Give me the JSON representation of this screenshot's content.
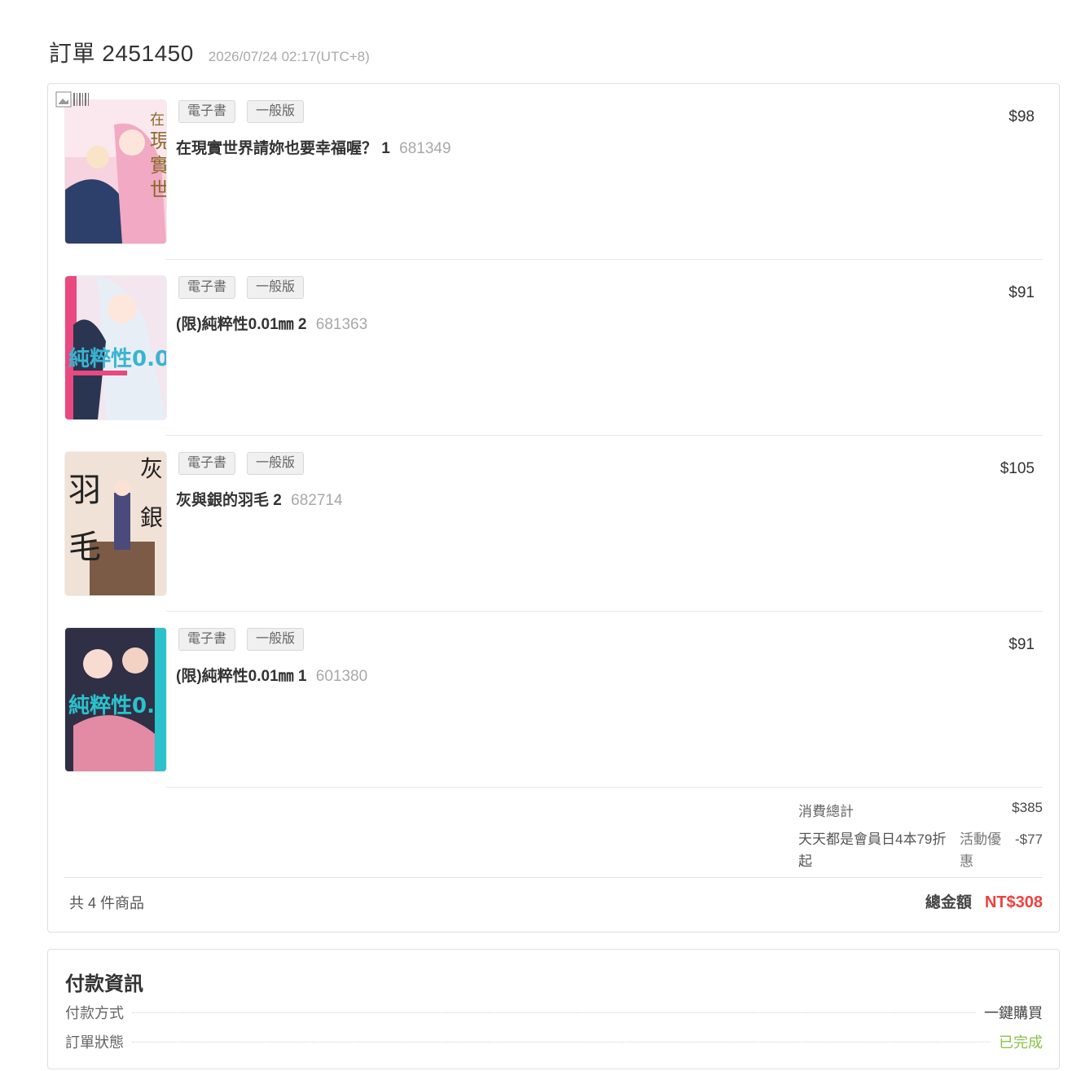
{
  "order": {
    "title": "訂單 2451450",
    "time": "2026/07/24 02:17(UTC+8)"
  },
  "items": [
    {
      "tags": [
        "電子書",
        "一般版"
      ],
      "name": "在現實世界請妳也要幸福喔？ 1",
      "code": "681349",
      "price": "$98",
      "cover_colors": [
        "#f6d3de",
        "#2d3f6b",
        "#f2a9c3"
      ]
    },
    {
      "tags": [
        "電子書",
        "一般版"
      ],
      "name": "(限)純粹性0.01㎜ 2",
      "code": "681363",
      "price": "$91",
      "cover_colors": [
        "#f3e6ee",
        "#e9497e",
        "#39b4cf"
      ]
    },
    {
      "tags": [
        "電子書",
        "一般版"
      ],
      "name": "灰與銀的羽毛 2",
      "code": "682714",
      "price": "$105",
      "cover_colors": [
        "#f0e2d6",
        "#7b5a46",
        "#4b4a7c"
      ]
    },
    {
      "tags": [
        "電子書",
        "一般版"
      ],
      "name": "(限)純粹性0.01㎜ 1",
      "code": "601380",
      "price": "$91",
      "cover_colors": [
        "#2f2f46",
        "#2bc2cc",
        "#e38aa4"
      ]
    }
  ],
  "summary": {
    "subtotal_label": "消費總計",
    "subtotal_value": "$385",
    "promo_name": "天天都是會員日4本79折起",
    "promo_tag": "活動優惠",
    "promo_value": "-$77"
  },
  "footer": {
    "count": "共 4 件商品",
    "total_label": "總金額",
    "total_value": "NT$308"
  },
  "payment": {
    "title": "付款資訊",
    "rows": [
      {
        "label": "付款方式",
        "value": "一鍵購買"
      },
      {
        "label": "訂單狀態",
        "value": "已完成"
      }
    ]
  }
}
